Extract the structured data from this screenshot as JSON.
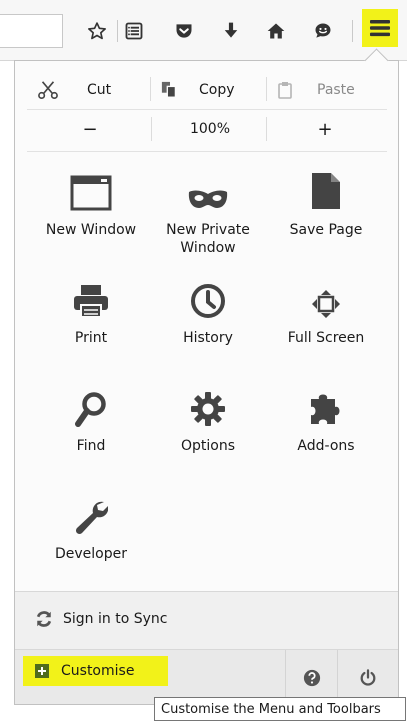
{
  "toolbar": {
    "buttons": [
      {
        "name": "bookmark-star-icon"
      },
      {
        "name": "bookmarks-list-icon"
      },
      {
        "name": "pocket-icon"
      },
      {
        "name": "downloads-icon"
      },
      {
        "name": "home-icon"
      },
      {
        "name": "hello-chat-icon"
      },
      {
        "name": "menu-hamburger-icon"
      }
    ],
    "highlight_color": "#f2f219"
  },
  "menu": {
    "edit": {
      "cut": "Cut",
      "copy": "Copy",
      "paste": "Paste"
    },
    "zoom": {
      "minus": "−",
      "level": "100%",
      "plus": "+"
    },
    "items": [
      {
        "label": "New Window",
        "icon": "new-window-icon"
      },
      {
        "label": "New Private\nWindow",
        "icon": "private-mask-icon"
      },
      {
        "label": "Save Page",
        "icon": "save-page-icon"
      },
      {
        "label": "Print",
        "icon": "print-icon"
      },
      {
        "label": "History",
        "icon": "history-clock-icon"
      },
      {
        "label": "Full Screen",
        "icon": "full-screen-icon"
      },
      {
        "label": "Find",
        "icon": "find-magnifier-icon"
      },
      {
        "label": "Options",
        "icon": "options-gear-icon"
      },
      {
        "label": "Add-ons",
        "icon": "addons-puzzle-icon"
      },
      {
        "label": "Developer",
        "icon": "developer-wrench-icon"
      }
    ],
    "sync_label": "Sign in to Sync",
    "customise_label": "Customise"
  },
  "tooltip": "Customise the Menu and Toolbars"
}
